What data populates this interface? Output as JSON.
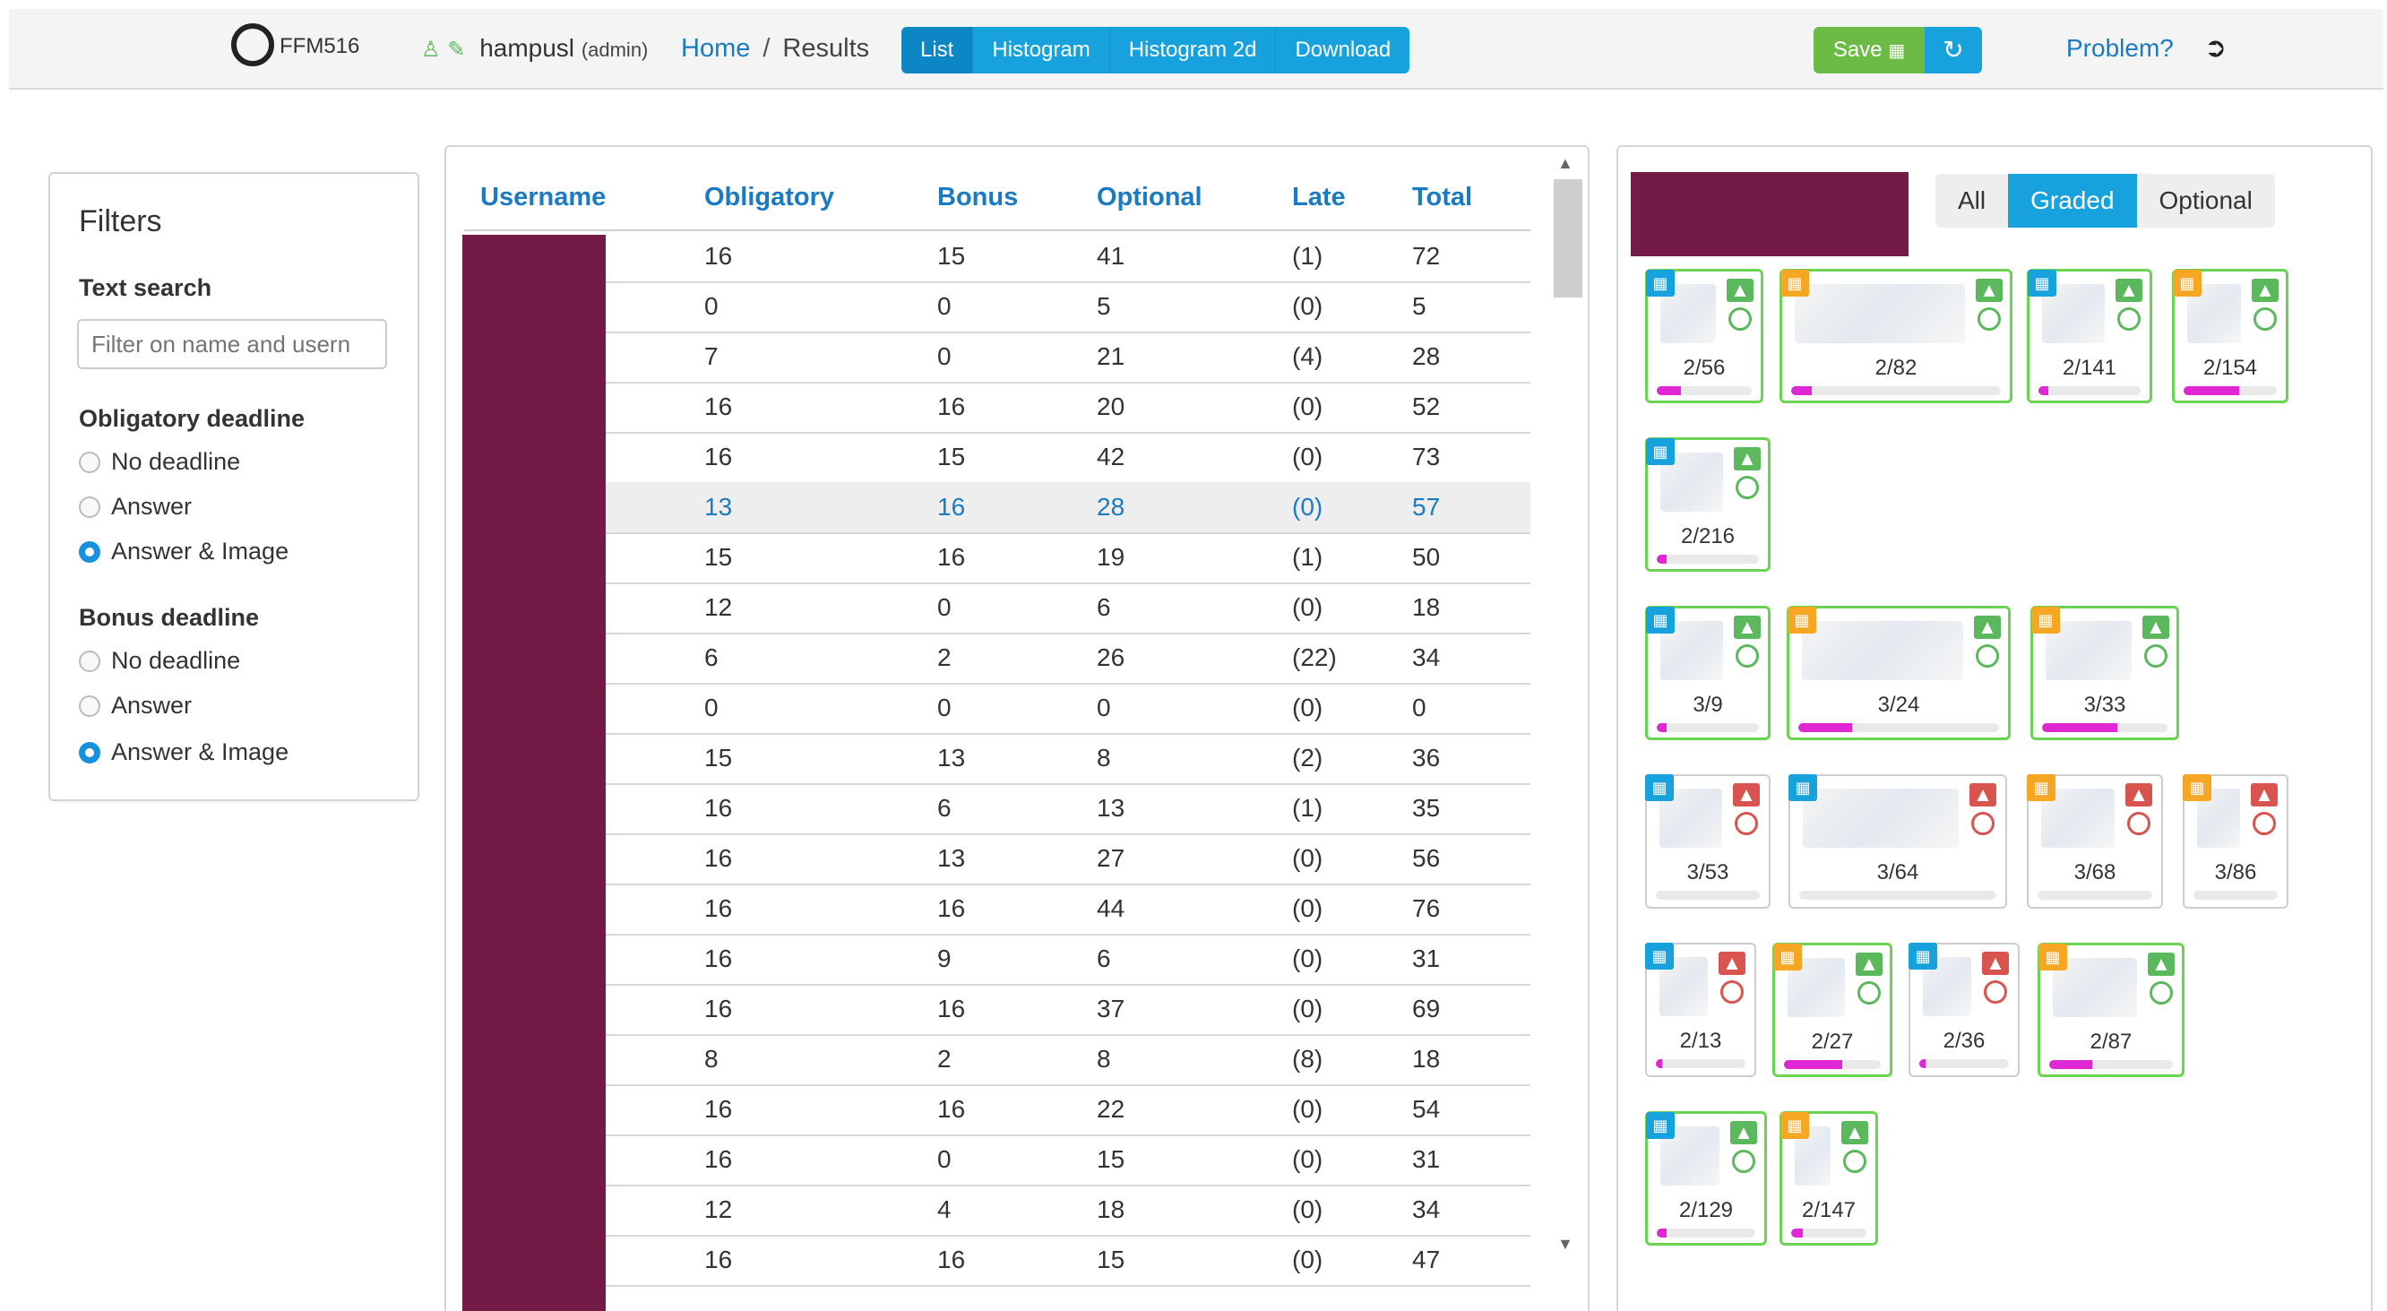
{
  "header": {
    "logo_text": "FFM516",
    "user_icon": "user-icon",
    "edit_icon": "pencil-icon",
    "username": "hampusl",
    "role": "(admin)",
    "breadcrumb_home": "Home",
    "breadcrumb_sep": "/",
    "breadcrumb_current": "Results",
    "views": [
      "List",
      "Histogram",
      "Histogram 2d",
      "Download"
    ],
    "save_label": "Save",
    "save_icon": "floppy-icon",
    "refresh_icon": "refresh-icon",
    "problem_label": "Problem?",
    "logout_icon": "sign-out-icon"
  },
  "filters": {
    "title": "Filters",
    "text_search_label": "Text search",
    "search_placeholder": "Filter on name and usern",
    "obligatory_label": "Obligatory deadline",
    "obligatory_options": [
      "No deadline",
      "Answer",
      "Answer & Image"
    ],
    "obligatory_selected": "Answer & Image",
    "bonus_label": "Bonus deadline",
    "bonus_options": [
      "No deadline",
      "Answer",
      "Answer & Image"
    ],
    "bonus_selected": "Answer & Image"
  },
  "table": {
    "columns": [
      "Username",
      "Obligatory",
      "Bonus",
      "Optional",
      "Late",
      "Total"
    ],
    "rows": [
      [
        "16",
        "15",
        "41",
        "(1)",
        "72"
      ],
      [
        "0",
        "0",
        "5",
        "(0)",
        "5"
      ],
      [
        "7",
        "0",
        "21",
        "(4)",
        "28"
      ],
      [
        "16",
        "16",
        "20",
        "(0)",
        "52"
      ],
      [
        "16",
        "15",
        "42",
        "(0)",
        "73"
      ],
      [
        "13",
        "16",
        "28",
        "(0)",
        "57"
      ],
      [
        "15",
        "16",
        "19",
        "(1)",
        "50"
      ],
      [
        "12",
        "0",
        "6",
        "(0)",
        "18"
      ],
      [
        "6",
        "2",
        "26",
        "(22)",
        "34"
      ],
      [
        "0",
        "0",
        "0",
        "(0)",
        "0"
      ],
      [
        "15",
        "13",
        "8",
        "(2)",
        "36"
      ],
      [
        "16",
        "6",
        "13",
        "(1)",
        "35"
      ],
      [
        "16",
        "13",
        "27",
        "(0)",
        "56"
      ],
      [
        "16",
        "16",
        "44",
        "(0)",
        "76"
      ],
      [
        "16",
        "9",
        "6",
        "(0)",
        "31"
      ],
      [
        "16",
        "16",
        "37",
        "(0)",
        "69"
      ],
      [
        "8",
        "2",
        "8",
        "(8)",
        "18"
      ],
      [
        "16",
        "16",
        "22",
        "(0)",
        "54"
      ],
      [
        "16",
        "0",
        "15",
        "(0)",
        "31"
      ],
      [
        "12",
        "4",
        "18",
        "(0)",
        "34"
      ],
      [
        "16",
        "16",
        "15",
        "(0)",
        "47"
      ]
    ],
    "highlight_row_index": 5
  },
  "right": {
    "tabs": [
      "All",
      "Graded",
      "Optional"
    ],
    "active_tab": "Graded",
    "colors": {
      "graded_border": "#6ad352",
      "progress": "#e027d4",
      "accent": "#17a2dd",
      "redacted": "#741a46"
    },
    "problems": [
      {
        "label": "2/56",
        "cal": "blue",
        "status": "ok",
        "progress": 0.25
      },
      {
        "label": "2/82",
        "cal": "orange",
        "status": "ok",
        "progress": 0.1
      },
      {
        "label": "2/141",
        "cal": "blue",
        "status": "ok",
        "progress": 0.1
      },
      {
        "label": "2/154",
        "cal": "orange",
        "status": "ok",
        "progress": 0.6
      },
      {
        "label": "2/216",
        "cal": "blue",
        "status": "ok",
        "progress": 0.1
      },
      {
        "label": "3/9",
        "cal": "blue",
        "status": "ok",
        "progress": 0.1
      },
      {
        "label": "3/24",
        "cal": "orange",
        "status": "ok",
        "progress": 0.27
      },
      {
        "label": "3/33",
        "cal": "orange",
        "status": "ok",
        "progress": 0.6
      },
      {
        "label": "3/53",
        "cal": "blue",
        "status": "bad",
        "progress": 0
      },
      {
        "label": "3/64",
        "cal": "blue",
        "status": "bad",
        "progress": 0
      },
      {
        "label": "3/68",
        "cal": "orange",
        "status": "bad",
        "progress": 0
      },
      {
        "label": "3/86",
        "cal": "orange",
        "status": "bad",
        "progress": 0
      },
      {
        "label": "2/13",
        "cal": "blue",
        "status": "bad",
        "progress": 0.07
      },
      {
        "label": "2/27",
        "cal": "orange",
        "status": "ok",
        "progress": 0.6
      },
      {
        "label": "2/36",
        "cal": "blue",
        "status": "bad",
        "progress": 0.07
      },
      {
        "label": "2/87",
        "cal": "orange",
        "status": "ok",
        "progress": 0.35
      },
      {
        "label": "2/129",
        "cal": "blue",
        "status": "ok",
        "progress": 0.1
      },
      {
        "label": "2/147",
        "cal": "orange",
        "status": "ok",
        "progress": 0.15
      }
    ]
  }
}
